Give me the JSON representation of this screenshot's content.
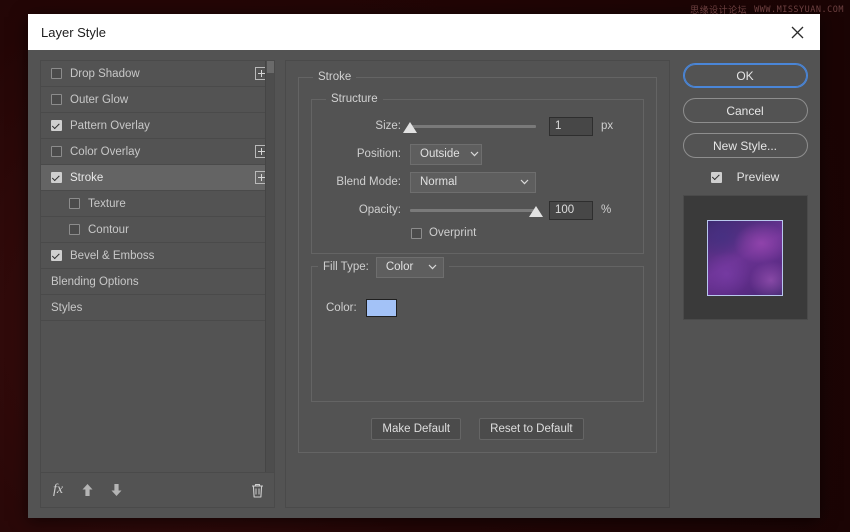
{
  "watermark": {
    "text_cn": "思缘设计论坛",
    "url": "WWW.MISSYUAN.COM"
  },
  "dialog": {
    "title": "Layer Style",
    "close_icon": "close-icon"
  },
  "sidebar": {
    "items": [
      {
        "label": "Styles",
        "checkbox": false,
        "checked": false,
        "indent": false,
        "selected": false,
        "plus": false
      },
      {
        "label": "Blending Options",
        "checkbox": false,
        "checked": false,
        "indent": false,
        "selected": false,
        "plus": false
      },
      {
        "label": "Bevel & Emboss",
        "checkbox": true,
        "checked": true,
        "indent": false,
        "selected": false,
        "plus": false
      },
      {
        "label": "Contour",
        "checkbox": true,
        "checked": false,
        "indent": true,
        "selected": false,
        "plus": false
      },
      {
        "label": "Texture",
        "checkbox": true,
        "checked": false,
        "indent": true,
        "selected": false,
        "plus": false
      },
      {
        "label": "Stroke",
        "checkbox": true,
        "checked": true,
        "indent": false,
        "selected": true,
        "plus": true
      },
      {
        "label": "Color Overlay",
        "checkbox": true,
        "checked": false,
        "indent": false,
        "selected": false,
        "plus": true
      },
      {
        "label": "Pattern Overlay",
        "checkbox": true,
        "checked": true,
        "indent": false,
        "selected": false,
        "plus": false
      },
      {
        "label": "Outer Glow",
        "checkbox": true,
        "checked": false,
        "indent": false,
        "selected": false,
        "plus": false
      },
      {
        "label": "Drop Shadow",
        "checkbox": true,
        "checked": false,
        "indent": false,
        "selected": false,
        "plus": true
      }
    ],
    "toolbar": {
      "fx_label": "fx",
      "move_up_icon": "arrow-up-icon",
      "move_down_icon": "arrow-down-icon",
      "delete_icon": "trash-icon"
    }
  },
  "main": {
    "group_title": "Stroke",
    "structure": {
      "legend": "Structure",
      "size": {
        "label": "Size:",
        "value": "1",
        "unit": "px",
        "percent": 0
      },
      "position": {
        "label": "Position:",
        "value": "Outside"
      },
      "blend_mode": {
        "label": "Blend Mode:",
        "value": "Normal"
      },
      "opacity": {
        "label": "Opacity:",
        "value": "100",
        "unit": "%",
        "percent": 100
      },
      "overprint": {
        "label": "Overprint",
        "checked": false
      }
    },
    "fill": {
      "type_label": "Fill Type:",
      "type_value": "Color",
      "color_label": "Color:",
      "color_value": "#a3c2f7"
    },
    "buttons": {
      "make_default": "Make Default",
      "reset_to_default": "Reset to Default"
    }
  },
  "actions": {
    "ok": "OK",
    "cancel": "Cancel",
    "new_style": "New Style...",
    "preview": {
      "label": "Preview",
      "checked": true
    }
  },
  "colors": {
    "accent": "#4a86d8",
    "dialog_bg": "#535353",
    "titlebar_bg": "#ffffff",
    "swatch": "#a3c2f7",
    "backdrop": "#2a0708"
  }
}
